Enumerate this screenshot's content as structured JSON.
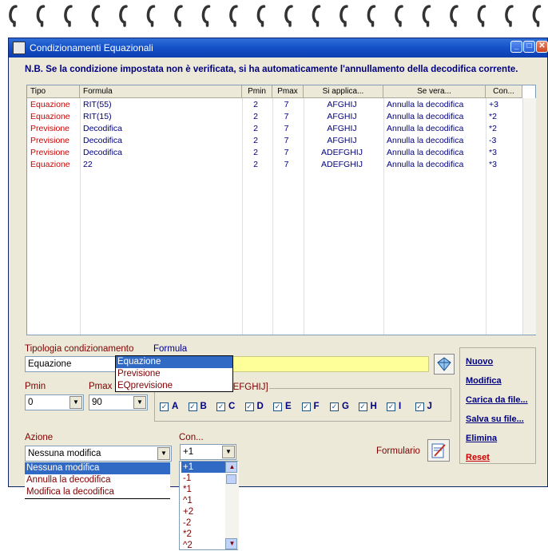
{
  "window": {
    "title": "Condizionamenti Equazionali"
  },
  "notice": "N.B. Se la condizione impostata non è verificata, si ha automaticamente l'annullamento della decodifica corrente.",
  "table": {
    "columns": [
      "Tipo",
      "Formula",
      "Pmin",
      "Pmax",
      "Si applica...",
      "Se vera...",
      "Con..."
    ],
    "rows": [
      [
        "Equazione",
        "RIT(55)",
        "2",
        "7",
        "AFGHIJ",
        "Annulla la decodifica",
        "+3"
      ],
      [
        "Equazione",
        "RIT(15)",
        "2",
        "7",
        "AFGHIJ",
        "Annulla la decodifica",
        "*2"
      ],
      [
        "Previsione",
        "Decodifica",
        "2",
        "7",
        "AFGHIJ",
        "Annulla la decodifica",
        "*2"
      ],
      [
        "Previsione",
        "Decodifica",
        "2",
        "7",
        "AFGHIJ",
        "Annulla la decodifica",
        "-3"
      ],
      [
        "Previsione",
        "Decodifica",
        "2",
        "7",
        "ADEFGHIJ",
        "Annulla la decodifica",
        "*3"
      ],
      [
        "Equazione",
        "22",
        "2",
        "7",
        "ADEFGHIJ",
        "Annulla la decodifica",
        "*3"
      ]
    ]
  },
  "form": {
    "tipologia_label": "Tipologia condizionamento",
    "tipologia_value": "Equazione",
    "tipologia_options": [
      "Equazione",
      "Previsione",
      "EQprevisione"
    ],
    "formula_label": "Formula",
    "formula_value": "",
    "pmin_label": "Pmin",
    "pmin_value": "0",
    "pmax_label": "Pmax",
    "pmax_value": "90",
    "applica_group_visible": "CDEFGHIJ]",
    "letters": [
      "A",
      "B",
      "C",
      "D",
      "E",
      "F",
      "G",
      "H",
      "I",
      "J"
    ],
    "azione_label": "Azione",
    "azione_value": "Nessuna modifica",
    "azione_options": [
      "Nessuna modifica",
      "Annulla la decodifica",
      "Modifica la decodifica"
    ],
    "con_label": "Con...",
    "con_value": "+1",
    "con_options": [
      "+1",
      "-1",
      "*1",
      "^1",
      "+2",
      "-2",
      "*2",
      "^2"
    ],
    "formulario_label": "Formulario"
  },
  "actions": [
    "Nuovo",
    "Modifica",
    "Carica da file...",
    "Salva su file...",
    "Elimina",
    "Reset"
  ],
  "colors": {
    "accent": "#000080",
    "label": "#800000",
    "highlight": "#316ac5",
    "formula_bg": "#ffff99",
    "reset": "#cc0000"
  }
}
